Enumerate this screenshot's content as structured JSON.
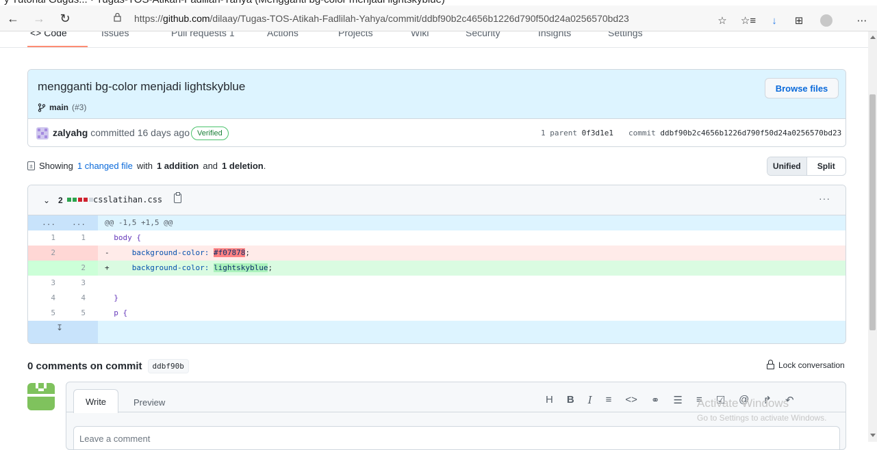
{
  "window": {
    "title_strip": "y Tutorial Gugus... · Tugas-TOS-Atikah-Fadlilah-Yahya (Mengganti bg-color menjadi lightskyblue)"
  },
  "browser": {
    "url_prefix": "https://",
    "url_host": "github.com",
    "url_path": "/dilaay/Tugas-TOS-Atikah-Fadlilah-Yahya/commit/ddbf90b2c4656b1226d790f50d24a0256570bd23",
    "icons": [
      "back-icon",
      "forward-icon",
      "refresh-icon",
      "lock-icon",
      "favorite-icon",
      "favorites-list-icon",
      "downloads-icon",
      "collections-icon",
      "profile-icon",
      "more-icon"
    ]
  },
  "repo_tabs": [
    "<> Code",
    "Issues",
    "Pull requests 1",
    "Actions",
    "Projects",
    "Wiki",
    "Security",
    "Insights",
    "Settings"
  ],
  "commit": {
    "title": "mengganti bg-color menjadi lightskyblue",
    "browse_files": "Browse files",
    "branch": "main",
    "pr_ref": "(#3)",
    "author": "zalyahg",
    "committed_text": "committed 16 days ago",
    "verified": "Verified",
    "parent_label": "1 parent",
    "parent_sha": "0f3d1e1",
    "commit_label": "commit",
    "commit_sha": "ddbf90b2c4656b1226d790f50d24a0256570bd23"
  },
  "summary": {
    "showing": "Showing",
    "changed": "1 changed file",
    "with": "with",
    "additions": "1 addition",
    "and": "and",
    "deletions": "1 deletion",
    "period": "."
  },
  "view_toggle": {
    "unified": "Unified",
    "split": "Split"
  },
  "diff": {
    "count": "2",
    "filename": "csslatihan.css",
    "more": "···",
    "hunk_left": "...",
    "hunk_right": "...",
    "hunk_header": "@@ -1,5 +1,5 @@",
    "lines": [
      {
        "old": "1",
        "new": "1",
        "sign": " ",
        "selector": "body {"
      },
      {
        "old": "2",
        "new": "",
        "sign": "-",
        "prop": "background-color:",
        "value": "#f07878",
        "end": ";"
      },
      {
        "old": "",
        "new": "2",
        "sign": "+",
        "prop": "background-color:",
        "value": "lightskyblue",
        "end": ";"
      },
      {
        "old": "3",
        "new": "3",
        "sign": " ",
        "selector": ""
      },
      {
        "old": "4",
        "new": "4",
        "sign": " ",
        "selector": "}"
      },
      {
        "old": "5",
        "new": "5",
        "sign": " ",
        "selector": "p {"
      }
    ],
    "stat_colors": [
      "#2da44e",
      "#2da44e",
      "#cf222e",
      "#cf222e",
      "#d0d7de"
    ]
  },
  "comments": {
    "title": "0 comments on commit",
    "sha": "ddbf90b",
    "lock": "Lock conversation",
    "write_tab": "Write",
    "preview_tab": "Preview",
    "placeholder": "Leave a comment",
    "toolbar": [
      "H",
      "B",
      "I",
      "≡",
      "<>",
      "🔗",
      "☰",
      "≡",
      "☑",
      "@",
      "↱",
      "↶"
    ]
  },
  "watermark": {
    "line1": "Activate Windows",
    "line2": "Go to Settings to activate Windows."
  },
  "colors": {
    "accent": "#0969da",
    "header_bg": "#ddf4ff",
    "del_bg": "#ffebe9",
    "add_bg": "#dafbe1",
    "verified": "#1a7f37"
  }
}
